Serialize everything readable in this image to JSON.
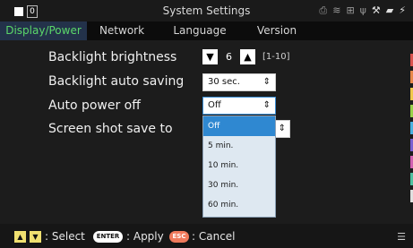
{
  "window": {
    "number": "0",
    "title": "System Settings"
  },
  "status_icons": [
    "printer-icon",
    "wifi-icon",
    "network-icon",
    "usb-icon",
    "tools-icon",
    "sd-card-icon",
    "power-icon"
  ],
  "tabs": [
    {
      "label": "Display/Power",
      "active": true
    },
    {
      "label": "Network",
      "active": false
    },
    {
      "label": "Language",
      "active": false
    },
    {
      "label": "Version",
      "active": false
    }
  ],
  "settings": {
    "brightness": {
      "label": "Backlight brightness",
      "value": "6",
      "range": "[1-10]"
    },
    "auto_saving": {
      "label": "Backlight auto saving",
      "value": "30 sec."
    },
    "auto_power_off": {
      "label": "Auto power off",
      "value": "Off"
    },
    "screenshot": {
      "label": "Screen shot save to"
    }
  },
  "dropdown": {
    "options": [
      "Off",
      "5 min.",
      "10 min.",
      "30 min.",
      "60 min."
    ],
    "selected": "Off"
  },
  "footer": {
    "select_text": ": Select",
    "enter_label": "ENTER",
    "apply_text": ": Apply",
    "esc_label": "ESC",
    "cancel_text": ": Cancel"
  },
  "colors": {
    "active_tab_text": "#5bd86a",
    "active_tab_bg": "#23324a",
    "selected_option": "#2f88d1",
    "dropdown_bg": "#dee8f1",
    "arrow_keys": "#f0e070",
    "esc_key": "#f07a5c",
    "strip": [
      "#d9534f",
      "#e8884a",
      "#f0c84a",
      "#9ad04a",
      "#4ab0e0",
      "#7a60d0",
      "#d060b0",
      "#50c0a0",
      "#e0e0e0"
    ]
  }
}
